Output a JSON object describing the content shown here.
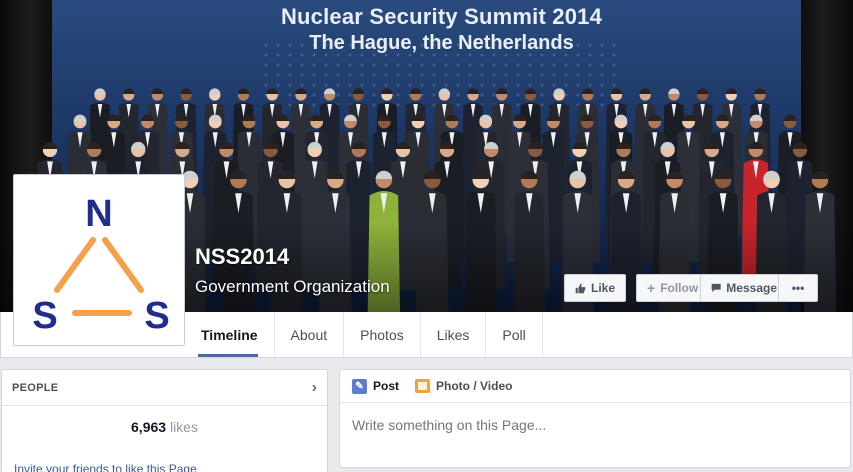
{
  "cover": {
    "title": "Nuclear Security Summit 2014",
    "subtitle": "The Hague, the Netherlands"
  },
  "page": {
    "name": "NSS2014",
    "category": "Government Organization",
    "logo_letters": [
      "N",
      "S",
      "S"
    ]
  },
  "actions": {
    "like": "Like",
    "follow": "Follow",
    "message": "Message",
    "more": "•••"
  },
  "tabs": [
    {
      "label": "Timeline",
      "active": true
    },
    {
      "label": "About"
    },
    {
      "label": "Photos"
    },
    {
      "label": "Likes"
    },
    {
      "label": "Poll"
    }
  ],
  "people": {
    "title": "PEOPLE",
    "likes_count": "6,963",
    "likes_label": "likes",
    "invite": "Invite your friends to like this Page"
  },
  "composer": {
    "post_tab": "Post",
    "photo_tab": "Photo / Video",
    "placeholder": "Write something on this Page..."
  },
  "colors": {
    "brand_blue": "#3b5998",
    "logo_blue": "#1f2d8c",
    "logo_orange": "#f5a04a"
  }
}
